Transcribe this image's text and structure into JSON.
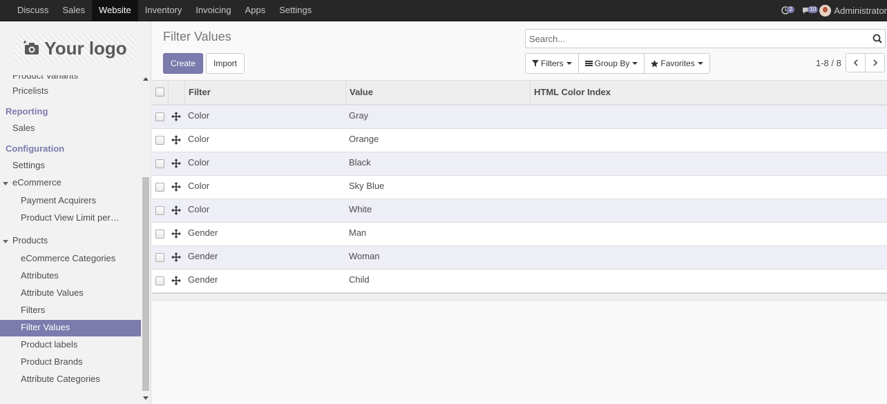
{
  "topbar": {
    "apps": [
      {
        "label": "Discuss",
        "active": false
      },
      {
        "label": "Sales",
        "active": false
      },
      {
        "label": "Website",
        "active": true
      },
      {
        "label": "Inventory",
        "active": false
      },
      {
        "label": "Invoicing",
        "active": false
      },
      {
        "label": "Apps",
        "active": false
      },
      {
        "label": "Settings",
        "active": false
      }
    ],
    "activities_count": "2",
    "messages_count": "10",
    "user_name": "Administrator"
  },
  "sidebar": {
    "logo_text": "Your logo",
    "items": [
      {
        "label": "Product Variants",
        "kind": "l1"
      },
      {
        "label": "Pricelists",
        "kind": "l1"
      },
      {
        "label": "Reporting",
        "kind": "section"
      },
      {
        "label": "Sales",
        "kind": "l1"
      },
      {
        "label": "Configuration",
        "kind": "section"
      },
      {
        "label": "Settings",
        "kind": "l1"
      },
      {
        "label": "eCommerce",
        "kind": "group"
      },
      {
        "label": "Payment Acquirers",
        "kind": "l2"
      },
      {
        "label": "Product View Limit per…",
        "kind": "l2"
      },
      {
        "label": "Products",
        "kind": "group"
      },
      {
        "label": "eCommerce Categories",
        "kind": "l2"
      },
      {
        "label": "Attributes",
        "kind": "l2"
      },
      {
        "label": "Attribute Values",
        "kind": "l2"
      },
      {
        "label": "Filters",
        "kind": "l2"
      },
      {
        "label": "Filter Values",
        "kind": "l2",
        "active": true
      },
      {
        "label": "Product labels",
        "kind": "l2"
      },
      {
        "label": "Product Brands",
        "kind": "l2"
      },
      {
        "label": "Attribute Categories",
        "kind": "l2"
      }
    ]
  },
  "control_panel": {
    "title": "Filter Values",
    "create_label": "Create",
    "import_label": "Import",
    "search_placeholder": "Search...",
    "filters_label": "Filters",
    "groupby_label": "Group By",
    "favorites_label": "Favorites",
    "pager": "1-8 / 8"
  },
  "table": {
    "columns": [
      "Filter",
      "Value",
      "HTML Color Index"
    ],
    "rows": [
      {
        "filter": "Color",
        "value": "Gray",
        "color_index": ""
      },
      {
        "filter": "Color",
        "value": "Orange",
        "color_index": ""
      },
      {
        "filter": "Color",
        "value": "Black",
        "color_index": ""
      },
      {
        "filter": "Color",
        "value": "Sky Blue",
        "color_index": ""
      },
      {
        "filter": "Color",
        "value": "White",
        "color_index": ""
      },
      {
        "filter": "Gender",
        "value": "Man",
        "color_index": ""
      },
      {
        "filter": "Gender",
        "value": "Woman",
        "color_index": ""
      },
      {
        "filter": "Gender",
        "value": "Child",
        "color_index": ""
      }
    ]
  },
  "colors": {
    "brand": "#7c7bad",
    "topbar": "#272727"
  }
}
